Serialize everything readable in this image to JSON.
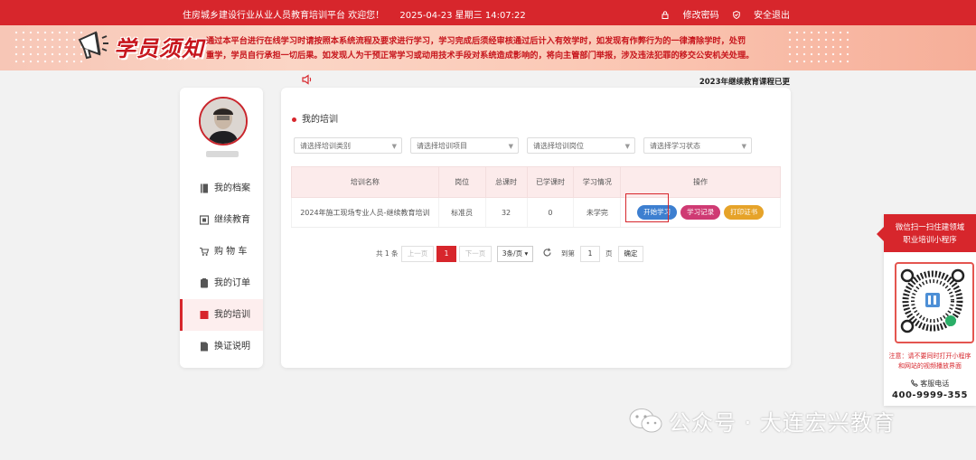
{
  "topbar": {
    "welcome": "住房城乡建设行业从业人员教育培训平台 欢迎您！",
    "datetime": "2025-04-23 星期三 14:07:22",
    "change_password": "修改密码",
    "logout": "安全退出"
  },
  "banner": {
    "title": "学员须知",
    "line1": "通过本平台进行在线学习时请按照本系统流程及要求进行学习，学习完成后须经审核通过后计入有效学时，如发现有作弊行为的一律清除学时，处罚",
    "line2": "重学，学员自行承担一切后果。如发现人为干预正常学习或动用技术手段对系统造成影响的，将向主管部门举报，涉及违法犯罪的移交公安机关处理。"
  },
  "announcement": "2023年继续教育课程已更",
  "sidebar": {
    "items": [
      {
        "label": "我的档案",
        "icon": "book-icon"
      },
      {
        "label": "继续教育",
        "icon": "monitor-icon"
      },
      {
        "label": "购 物 车",
        "icon": "cart-icon"
      },
      {
        "label": "我的订单",
        "icon": "order-icon"
      },
      {
        "label": "我的培训",
        "icon": "training-icon"
      },
      {
        "label": "换证说明",
        "icon": "document-icon"
      }
    ],
    "active_index": 4
  },
  "main": {
    "section_title": "我的培训",
    "filters": [
      "请选择培训类别",
      "请选择培训项目",
      "请选择培训岗位",
      "请选择学习状态"
    ],
    "table": {
      "headers": [
        "培训名称",
        "岗位",
        "总课时",
        "已学课时",
        "学习情况",
        "操作"
      ],
      "rows": [
        {
          "name": "2024年施工现场专业人员-继续教育培训",
          "position": "标准员",
          "total_hours": "32",
          "learned_hours": "0",
          "status": "未学完",
          "actions": [
            "开始学习",
            "学习记录",
            "打印证书"
          ]
        }
      ]
    },
    "pagination": {
      "total": "共 1 条",
      "prev": "上一页",
      "current": "1",
      "next": "下一页",
      "page_size": "3条/页",
      "goto_label": "到第",
      "goto_value": "1",
      "page_unit": "页",
      "confirm": "确定"
    }
  },
  "qr_panel": {
    "head_line1": "微信扫一扫住建领域",
    "head_line2": "职业培训小程序",
    "note": "注意：请不要同时打开小程序和网站的视频播放界面",
    "service_label": "客服电话",
    "phone": "400-9999-355"
  },
  "watermark": "公众号 · 大连宏兴教育",
  "colors": {
    "primary": "#d7262c",
    "start_btn": "#3d7fd0",
    "record_btn": "#cf3a73",
    "print_btn": "#e6a329"
  }
}
